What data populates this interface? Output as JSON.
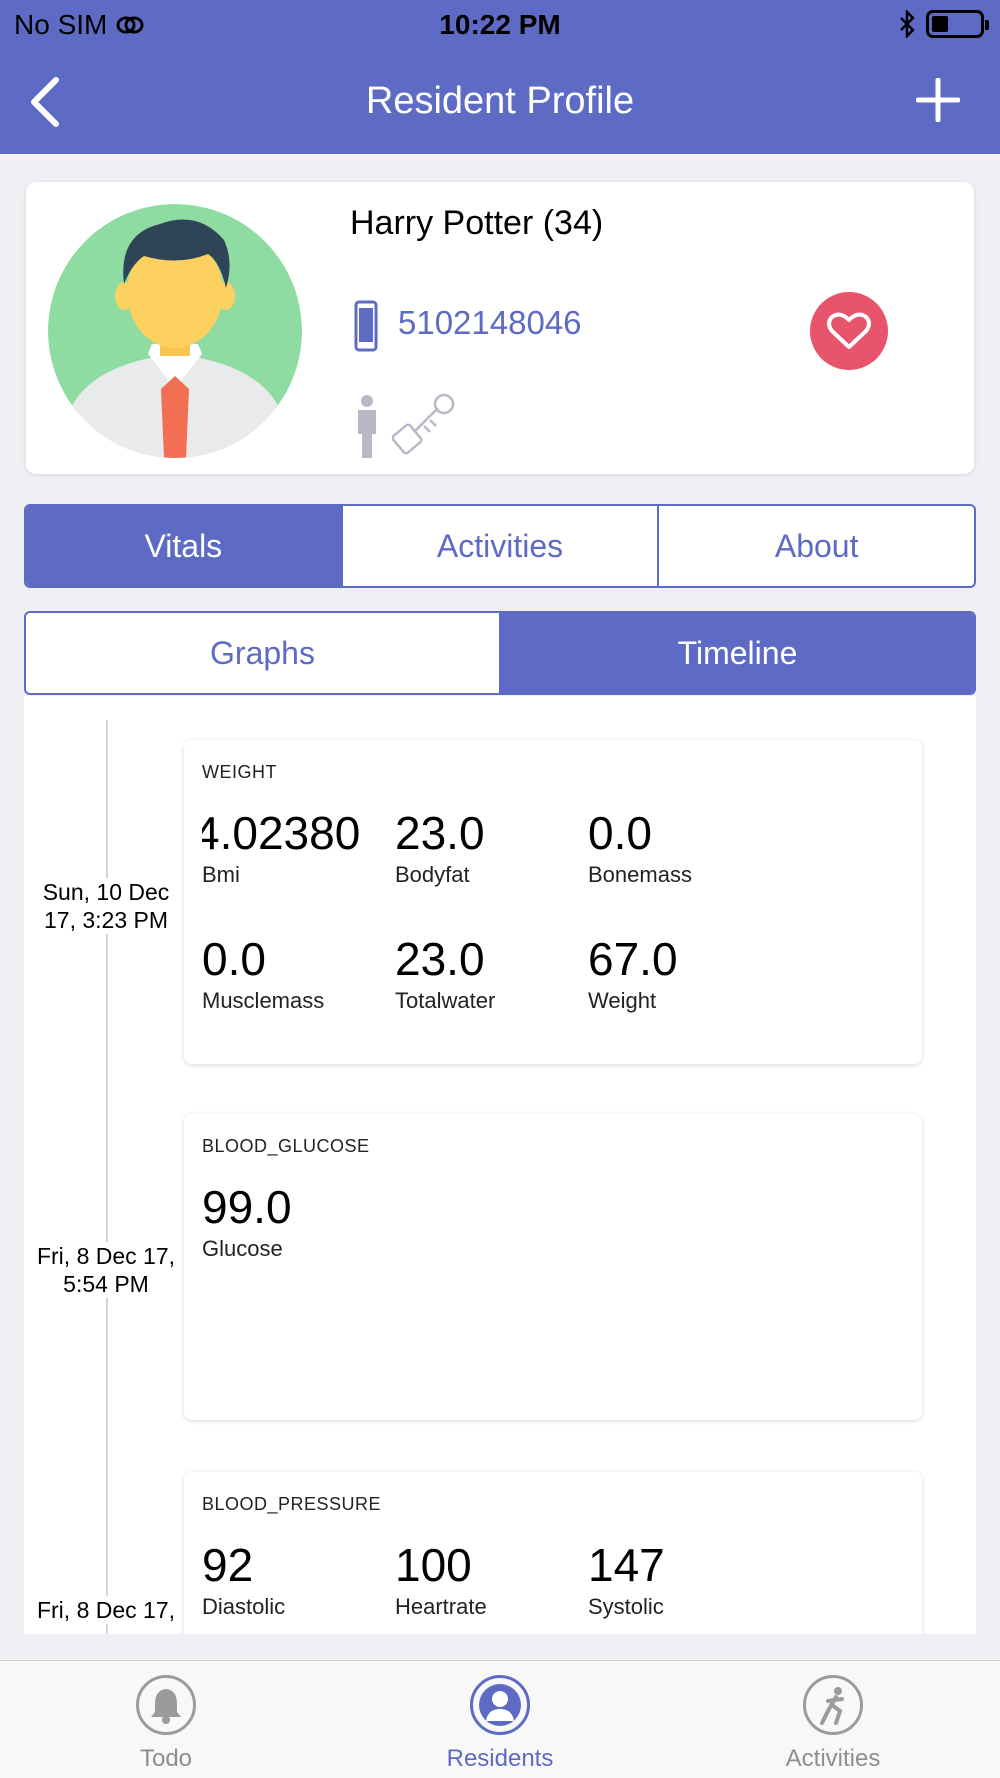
{
  "status_bar": {
    "carrier": "No SIM",
    "time": "10:22 PM"
  },
  "nav": {
    "title": "Resident Profile",
    "back_icon": "chevron-left-icon",
    "add_icon": "plus-icon"
  },
  "profile": {
    "name": "Harry Potter (34)",
    "phone": "5102148046",
    "avatar_icon": "avatar-male-icon",
    "heart_icon": "heart-icon"
  },
  "main_tabs": [
    "Vitals",
    "Activities",
    "About"
  ],
  "main_tabs_active": 0,
  "sub_tabs": [
    "Graphs",
    "Timeline"
  ],
  "sub_tabs_active": 1,
  "timeline": [
    {
      "date_line1": "Sun, 10 Dec",
      "date_line2": "17, 3:23 PM",
      "type": "WEIGHT",
      "metrics": [
        {
          "value": "4.02380",
          "label": "Bmi"
        },
        {
          "value": "23.0",
          "label": "Bodyfat"
        },
        {
          "value": "0.0",
          "label": "Bonemass"
        },
        {
          "value": "0.0",
          "label": "Musclemass"
        },
        {
          "value": "23.0",
          "label": "Totalwater"
        },
        {
          "value": "67.0",
          "label": "Weight"
        }
      ]
    },
    {
      "date_line1": "Fri, 8 Dec 17,",
      "date_line2": "5:54 PM",
      "type": "BLOOD_GLUCOSE",
      "metrics": [
        {
          "value": "99.0",
          "label": "Glucose"
        }
      ]
    },
    {
      "date_line1": "Fri, 8 Dec 17,",
      "date_line2": "",
      "type": "BLOOD_PRESSURE",
      "metrics": [
        {
          "value": "92",
          "label": "Diastolic"
        },
        {
          "value": "100",
          "label": "Heartrate"
        },
        {
          "value": "147",
          "label": "Systolic"
        }
      ]
    }
  ],
  "tab_bar": [
    {
      "label": "Todo",
      "icon": "bell-icon",
      "active": false
    },
    {
      "label": "Residents",
      "icon": "person-icon",
      "active": true
    },
    {
      "label": "Activities",
      "icon": "running-icon",
      "active": false
    }
  ],
  "colors": {
    "primary": "#5e6bc4",
    "heart": "#e8546b",
    "background": "#efeff4"
  }
}
